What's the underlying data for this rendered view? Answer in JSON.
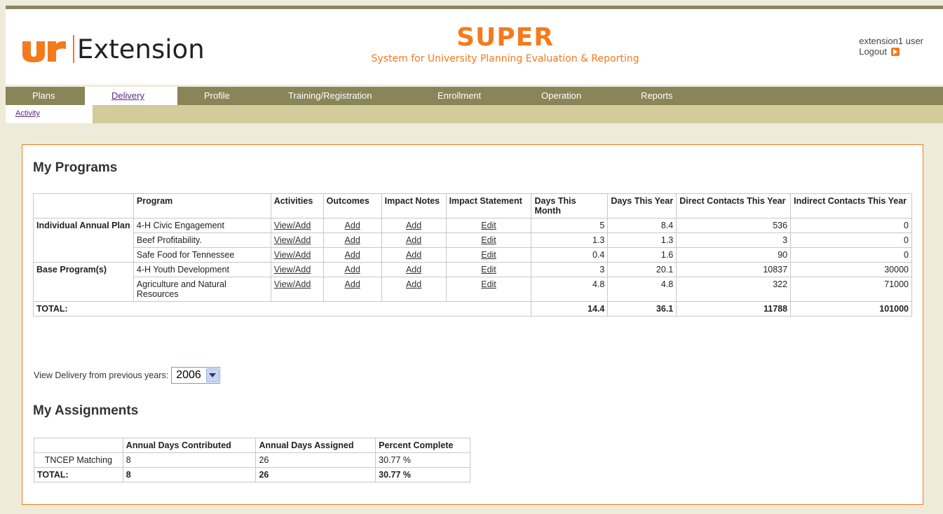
{
  "header": {
    "logo_text": "Extension",
    "app_name": "SUPER",
    "app_subtitle": "System for University Planning Evaluation & Reporting",
    "user_label": "extension1 user",
    "logout_label": "Logout",
    "accent_color": "#f47a1e",
    "nav_color": "#8a8459"
  },
  "nav": {
    "items": [
      "Plans",
      "Delivery",
      "Profile",
      "Training/Registration",
      "Enrollment",
      "Operation",
      "Reports"
    ],
    "active": "Delivery"
  },
  "subnav": {
    "items": [
      "Activity"
    ]
  },
  "programs": {
    "title": "My Programs",
    "headers": [
      "Program",
      "Activities",
      "Outcomes",
      "Impact Notes",
      "Impact Statement",
      "Days This Month",
      "Days This Year",
      "Direct Contacts This Year",
      "Indirect Contacts This Year"
    ],
    "groups": [
      "Individual Annual Plan",
      "Base Program(s)"
    ],
    "rows": [
      {
        "program": "4-H Civic Engagement",
        "activities": "View/Add",
        "outcomes": "Add",
        "notes": "Add",
        "statement": "Edit",
        "days_month": "5",
        "days_year": "8.4",
        "direct": "536",
        "indirect": "0"
      },
      {
        "program": "Beef Profitability.",
        "activities": "View/Add",
        "outcomes": "Add",
        "notes": "Add",
        "statement": "Edit",
        "days_month": "1.3",
        "days_year": "1.3",
        "direct": "3",
        "indirect": "0"
      },
      {
        "program": "Safe Food for Tennessee",
        "activities": "View/Add",
        "outcomes": "Add",
        "notes": "Add",
        "statement": "Edit",
        "days_month": "0.4",
        "days_year": "1.6",
        "direct": "90",
        "indirect": "0"
      },
      {
        "program": "4-H Youth Development",
        "activities": "View/Add",
        "outcomes": "Add",
        "notes": "Add",
        "statement": "Edit",
        "days_month": "3",
        "days_year": "20.1",
        "direct": "10837",
        "indirect": "30000"
      },
      {
        "program": "Agriculture and Natural Resources",
        "activities": "View/Add",
        "outcomes": "Add",
        "notes": "Add",
        "statement": "Edit",
        "days_month": "4.8",
        "days_year": "4.8",
        "direct": "322",
        "indirect": "71000"
      }
    ],
    "total": {
      "label": "TOTAL:",
      "days_month": "14.4",
      "days_year": "36.1",
      "direct": "11788",
      "indirect": "101000"
    }
  },
  "year_select": {
    "label": "View Delivery from previous years:",
    "value": "2006"
  },
  "assignments": {
    "title": "My Assignments",
    "headers": [
      "Annual Days Contributed",
      "Annual Days Assigned",
      "Percent Complete"
    ],
    "rows": [
      {
        "name": "TNCEP Matching",
        "contributed": "8",
        "assigned": "26",
        "percent": "30.77 %"
      }
    ],
    "total": {
      "label": "TOTAL:",
      "contributed": "8",
      "assigned": "26",
      "percent": "30.77 %"
    }
  }
}
